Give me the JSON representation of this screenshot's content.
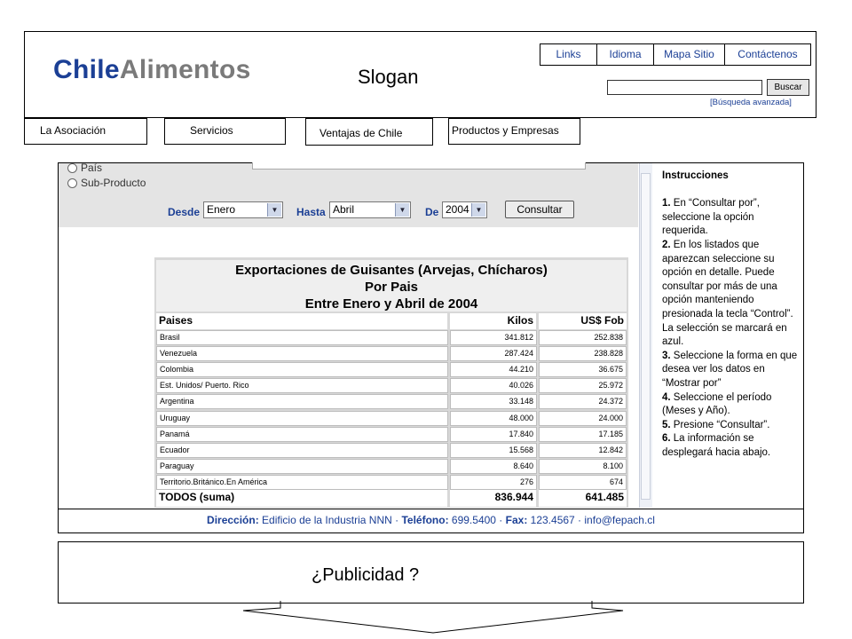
{
  "logo": {
    "part1": "Chile",
    "part2": "Alimentos"
  },
  "slogan": "Slogan",
  "top_nav": [
    "Links",
    "Idioma",
    "Mapa Sitio",
    "Contáctenos"
  ],
  "search": {
    "button": "Buscar",
    "advanced": "[Búsqueda avanzada]"
  },
  "main_tabs": [
    "La Asociación",
    "Servicios",
    "Ventajas de Chile",
    "Productos y Empresas"
  ],
  "form": {
    "radio_pais": "País",
    "radio_sub": "Sub-Producto",
    "desde_label": "Desde",
    "desde_value": "Enero",
    "hasta_label": "Hasta",
    "hasta_value": "Abril",
    "de_label": "De",
    "de_value": "2004",
    "consultar": "Consultar"
  },
  "table": {
    "title1": "Exportaciones de Guisantes (Arvejas, Chícharos)",
    "title2": "Por Pais",
    "title3": "Entre Enero y Abril de 2004",
    "headers": [
      "Paises",
      "Kilos",
      "US$ Fob"
    ],
    "rows": [
      [
        "Brasil",
        "341.812",
        "252.838"
      ],
      [
        "Venezuela",
        "287.424",
        "238.828"
      ],
      [
        "Colombia",
        "44.210",
        "36.675"
      ],
      [
        "Est. Unidos/ Puerto. Rico",
        "40.026",
        "25.972"
      ],
      [
        "Argentina",
        "33.148",
        "24.372"
      ],
      [
        "Uruguay",
        "48.000",
        "24.000"
      ],
      [
        "Panamá",
        "17.840",
        "17.185"
      ],
      [
        "Ecuador",
        "15.568",
        "12.842"
      ],
      [
        "Paraguay",
        "8.640",
        "8.100"
      ],
      [
        "Territorio.Británico.En América",
        "276",
        "674"
      ]
    ],
    "total": [
      "TODOS (suma)",
      "836.944",
      "641.485"
    ]
  },
  "instructions": {
    "title": "Instrucciones",
    "steps": [
      {
        "n": "1.",
        "t": " En “Consultar por”, seleccione la opción requerida."
      },
      {
        "n": "2.",
        "t": " En los listados que aparezcan seleccione su opción en detalle. Puede consultar por más de una opción manteniendo presionada la tecla “Control”. La selección se marcará en azul."
      },
      {
        "n": "3.",
        "t": " Seleccione la forma en que desea ver los datos en “Mostrar por”"
      },
      {
        "n": "4.",
        "t": " Seleccione el período (Meses y Año)."
      },
      {
        "n": "5.",
        "t": " Presione “Consultar”."
      },
      {
        "n": "6.",
        "t": " La información se desplegará hacia abajo."
      }
    ]
  },
  "footer": {
    "dir_label": "Dirección:",
    "dir_value": " Edificio de la Industria NNN",
    "tel_label": "Teléfono:",
    "tel_value": " 699.5400",
    "fax_label": "Fax:",
    "fax_value": " 123.4567",
    "email": "info@fepach.cl"
  },
  "ad": "¿Publicidad ?"
}
